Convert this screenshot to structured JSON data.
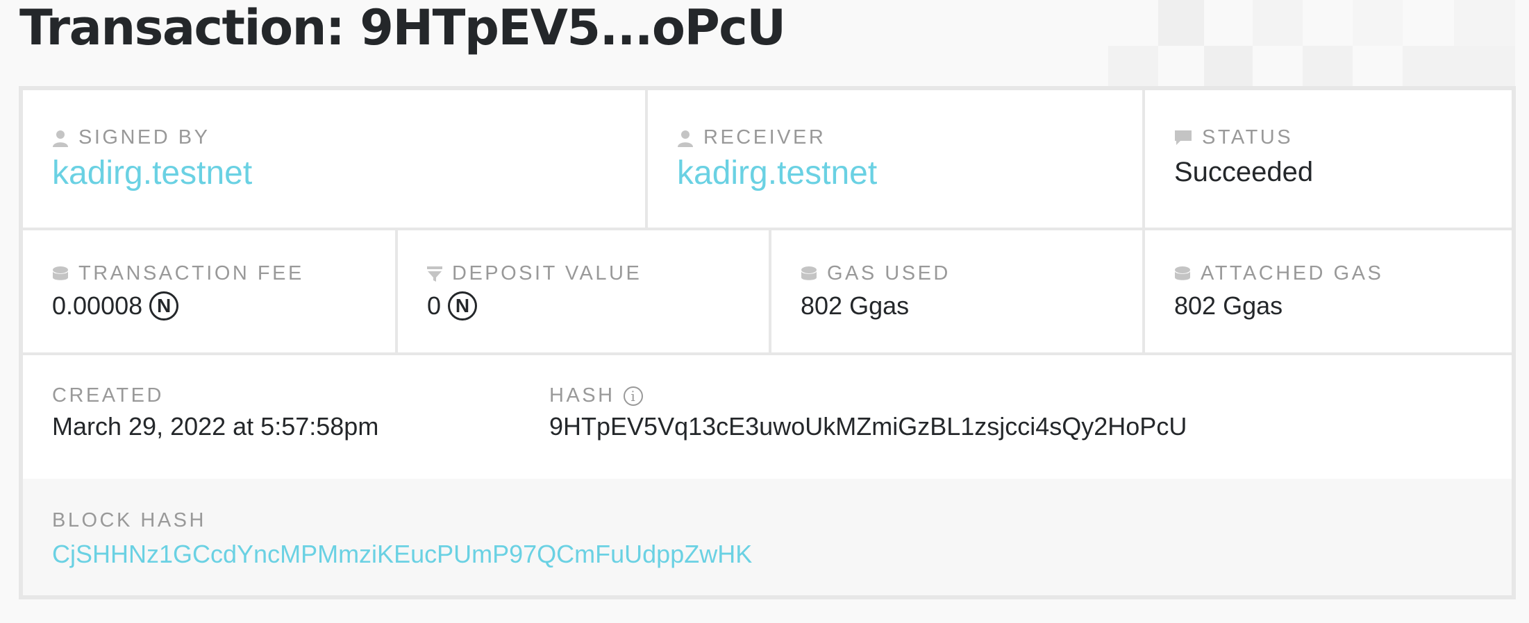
{
  "page": {
    "title": "Transaction: 9HTpEV5...oPcU"
  },
  "signed_by": {
    "label": "SIGNED BY",
    "value": "kadirg.testnet",
    "icon": "person-icon"
  },
  "receiver": {
    "label": "RECEIVER",
    "value": "kadirg.testnet",
    "icon": "person-icon"
  },
  "status": {
    "label": "STATUS",
    "value": "Succeeded",
    "icon": "speech-bubble-icon"
  },
  "transaction_fee": {
    "label": "TRANSACTION FEE",
    "value": "0.00008",
    "unit_glyph": "N",
    "icon": "coin-stack-icon"
  },
  "deposit_value": {
    "label": "DEPOSIT VALUE",
    "value": "0",
    "unit_glyph": "N",
    "icon": "filter-icon"
  },
  "gas_used": {
    "label": "GAS USED",
    "value": "802 Ggas",
    "icon": "coin-stack-icon"
  },
  "attached_gas": {
    "label": "ATTACHED GAS",
    "value": "802 Ggas",
    "icon": "coin-stack-icon"
  },
  "created": {
    "label": "CREATED",
    "value": "March 29, 2022 at 5:57:58pm"
  },
  "hash": {
    "label": "HASH",
    "value": "9HTpEV5Vq13cE3uwoUkMZmiGzBL1zsjcci4sQy2HoPcU",
    "info_glyph": "i"
  },
  "block_hash": {
    "label": "BLOCK HASH",
    "value": "CjSHHNz1GCcdYncMPMmziKEucPUmP97QCmFuUdppZwHK"
  },
  "colors": {
    "link": "#6ad1e3",
    "label": "#999999",
    "text": "#24272a",
    "border": "#e7e7e7"
  }
}
